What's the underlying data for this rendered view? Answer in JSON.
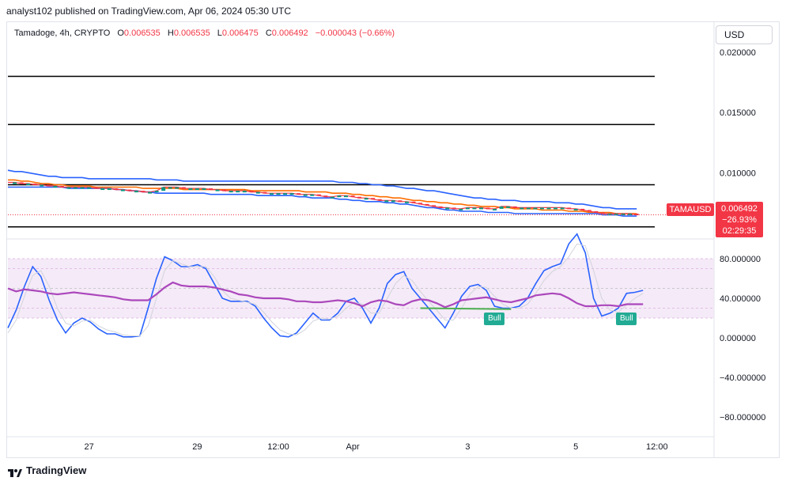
{
  "header": {
    "publisher": "analyst102 published on TradingView.com, Apr 06, 2024 05:30 UTC"
  },
  "legend": {
    "symbol": "Tamadoge, 4h, CRYPTO",
    "open_label": "O",
    "open": "0.006535",
    "high_label": "H",
    "high": "0.006535",
    "low_label": "L",
    "low": "0.006475",
    "close_label": "C",
    "close": "0.006492",
    "change": "−0.000043 (−0.66%)"
  },
  "currency_button": "USD",
  "price_tag": {
    "symbol": "TAMAUSD",
    "price": "0.006492",
    "change": "−26.93%",
    "countdown": "02:29:35"
  },
  "footer": {
    "brand": "TradingView"
  },
  "chart_data": [
    {
      "type": "line",
      "panel": "price",
      "y_ticks": [
        "0.020000",
        "0.015000",
        "0.010000"
      ],
      "ylim": [
        0.0045,
        0.0225
      ],
      "horizontal_levels": [
        0.018,
        0.014,
        0.009,
        0.0055
      ],
      "x_tick_labels": [
        "27",
        "29",
        "12:00",
        "Apr",
        "3",
        "5",
        "12:00"
      ],
      "x_tick_index": [
        12,
        28,
        40,
        51,
        68,
        84,
        96
      ],
      "series": [
        {
          "role": "upper_band",
          "color": "#2962ff",
          "values": [
            0.0102,
            0.0101,
            0.0101,
            0.01,
            0.0099,
            0.0098,
            0.0097,
            0.0097,
            0.0096,
            0.0096,
            0.0096,
            0.0096,
            0.0095,
            0.0095,
            0.0095,
            0.0095,
            0.0095,
            0.0095,
            0.0095,
            0.0095,
            0.0095,
            0.0095,
            0.0094,
            0.0094,
            0.0094,
            0.0094,
            0.0093,
            0.0093,
            0.0093,
            0.0093,
            0.0093,
            0.0093,
            0.0093,
            0.0093,
            0.0093,
            0.0093,
            0.0093,
            0.0093,
            0.0093,
            0.0093,
            0.0093,
            0.0093,
            0.0093,
            0.0093,
            0.0093,
            0.0093,
            0.0093,
            0.0093,
            0.0093,
            0.0092,
            0.0092,
            0.0092,
            0.0091,
            0.0091,
            0.009,
            0.009,
            0.0089,
            0.0089,
            0.0088,
            0.0087,
            0.0087,
            0.0086,
            0.0085,
            0.0085,
            0.0084,
            0.0083,
            0.0082,
            0.0081,
            0.008,
            0.0079,
            0.0079,
            0.0078,
            0.0078,
            0.0077,
            0.0077,
            0.0077,
            0.0076,
            0.0076,
            0.0076,
            0.0076,
            0.0076,
            0.0075,
            0.0075,
            0.0075,
            0.0074,
            0.0074,
            0.0073,
            0.0072,
            0.0071,
            0.0071,
            0.007,
            0.007,
            0.007,
            0.007
          ]
        },
        {
          "role": "middle_band",
          "color": "#ff6d00",
          "values": [
            0.0094,
            0.0094,
            0.0093,
            0.0093,
            0.0092,
            0.0091,
            0.0091,
            0.009,
            0.009,
            0.0089,
            0.0089,
            0.0089,
            0.0089,
            0.0088,
            0.0088,
            0.0088,
            0.0088,
            0.0088,
            0.0088,
            0.0088,
            0.0087,
            0.0087,
            0.0087,
            0.0087,
            0.0087,
            0.0087,
            0.0086,
            0.0086,
            0.0086,
            0.0086,
            0.0086,
            0.0086,
            0.0086,
            0.0086,
            0.0086,
            0.0086,
            0.0085,
            0.0085,
            0.0085,
            0.0085,
            0.0085,
            0.0085,
            0.0085,
            0.0085,
            0.0084,
            0.0084,
            0.0084,
            0.0084,
            0.0083,
            0.0083,
            0.0083,
            0.0082,
            0.0082,
            0.0081,
            0.0081,
            0.008,
            0.008,
            0.0079,
            0.0079,
            0.0078,
            0.0077,
            0.0077,
            0.0076,
            0.0076,
            0.0075,
            0.0075,
            0.0074,
            0.0074,
            0.0073,
            0.0073,
            0.0072,
            0.0072,
            0.0072,
            0.0071,
            0.0071,
            0.007,
            0.007,
            0.007,
            0.007,
            0.0069,
            0.0069,
            0.0069,
            0.0069,
            0.0068,
            0.0068,
            0.0068,
            0.0067,
            0.0067,
            0.0067,
            0.0067,
            0.0066,
            0.0066,
            0.0066,
            0.0066
          ]
        },
        {
          "role": "lower_band",
          "color": "#2962ff",
          "values": [
            0.0088,
            0.0088,
            0.0088,
            0.0088,
            0.0088,
            0.0088,
            0.0088,
            0.0088,
            0.0088,
            0.0087,
            0.0087,
            0.0087,
            0.0087,
            0.0087,
            0.0087,
            0.0087,
            0.0086,
            0.0086,
            0.0085,
            0.0085,
            0.0084,
            0.0084,
            0.0083,
            0.0083,
            0.0083,
            0.0083,
            0.0083,
            0.0083,
            0.0083,
            0.0083,
            0.0082,
            0.0082,
            0.0082,
            0.0082,
            0.0082,
            0.0082,
            0.0082,
            0.0081,
            0.0081,
            0.0081,
            0.0081,
            0.0081,
            0.0081,
            0.008,
            0.008,
            0.0079,
            0.0079,
            0.0079,
            0.0079,
            0.0078,
            0.0078,
            0.0077,
            0.0077,
            0.0076,
            0.0076,
            0.0076,
            0.0075,
            0.0075,
            0.0074,
            0.0074,
            0.0073,
            0.0072,
            0.0071,
            0.0071,
            0.007,
            0.0069,
            0.0069,
            0.0068,
            0.0068,
            0.0068,
            0.0068,
            0.0067,
            0.0067,
            0.0067,
            0.0067,
            0.0066,
            0.0066,
            0.0066,
            0.0066,
            0.0066,
            0.0066,
            0.0066,
            0.0066,
            0.0066,
            0.0066,
            0.0066,
            0.0066,
            0.0066,
            0.0065,
            0.0065,
            0.0065,
            0.0064,
            0.0064,
            0.0064
          ]
        },
        {
          "role": "price",
          "color": "#f23645",
          "values": [
            0.0092,
            0.0092,
            0.0091,
            0.0091,
            0.009,
            0.009,
            0.0089,
            0.0089,
            0.0088,
            0.0088,
            0.0088,
            0.0088,
            0.0088,
            0.0087,
            0.0087,
            0.0087,
            0.0086,
            0.0086,
            0.0085,
            0.0085,
            0.0084,
            0.0084,
            0.0085,
            0.0088,
            0.0088,
            0.0088,
            0.0087,
            0.0087,
            0.0087,
            0.0087,
            0.0086,
            0.0086,
            0.0085,
            0.0085,
            0.0085,
            0.0085,
            0.0084,
            0.0084,
            0.0083,
            0.0083,
            0.0083,
            0.0083,
            0.0083,
            0.0082,
            0.0082,
            0.0082,
            0.0081,
            0.008,
            0.008,
            0.0081,
            0.0081,
            0.008,
            0.0079,
            0.0079,
            0.0078,
            0.0077,
            0.0077,
            0.0077,
            0.0076,
            0.0076,
            0.0075,
            0.0074,
            0.0073,
            0.0072,
            0.0071,
            0.0071,
            0.007,
            0.007,
            0.0071,
            0.0071,
            0.0071,
            0.007,
            0.007,
            0.0072,
            0.0072,
            0.0071,
            0.0071,
            0.0071,
            0.0071,
            0.0071,
            0.0071,
            0.0071,
            0.0071,
            0.007,
            0.007,
            0.0069,
            0.0068,
            0.0067,
            0.0066,
            0.0066,
            0.0066,
            0.0066,
            0.0066,
            0.0065
          ]
        }
      ]
    },
    {
      "type": "line",
      "panel": "stochastic_rsi",
      "y_ticks": [
        "80.000000",
        "40.000000",
        "0.000000",
        "−40.000000",
        "−80.000000"
      ],
      "ylim": [
        -100,
        100
      ],
      "bands": [
        80,
        70,
        50,
        30,
        20
      ],
      "signals": [
        {
          "label": "Bull",
          "index": 59
        },
        {
          "label": "Bull",
          "index": 75
        }
      ],
      "series": [
        {
          "role": "k",
          "color": "#2962ff",
          "values": [
            10,
            28,
            52,
            72,
            62,
            38,
            18,
            5,
            15,
            20,
            16,
            9,
            4,
            4,
            1,
            1,
            2,
            30,
            60,
            82,
            78,
            72,
            72,
            74,
            70,
            55,
            40,
            37,
            37,
            37,
            32,
            20,
            10,
            2,
            1,
            5,
            15,
            25,
            18,
            18,
            25,
            37,
            40,
            30,
            15,
            30,
            55,
            64,
            67,
            50,
            40,
            30,
            20,
            10,
            25,
            42,
            52,
            54,
            48,
            32,
            30,
            30,
            32,
            40,
            55,
            68,
            72,
            75,
            95,
            105,
            86,
            40,
            22,
            25,
            30,
            45,
            46,
            48
          ]
        },
        {
          "role": "d",
          "color": "#d1d4dc",
          "values": [
            5,
            18,
            42,
            63,
            68,
            52,
            30,
            15,
            12,
            17,
            18,
            12,
            8,
            6,
            3,
            2,
            2,
            12,
            40,
            68,
            78,
            75,
            72,
            72,
            72,
            62,
            48,
            40,
            38,
            36,
            34,
            26,
            16,
            8,
            4,
            3,
            8,
            17,
            20,
            19,
            22,
            30,
            36,
            34,
            25,
            25,
            40,
            55,
            63,
            58,
            47,
            37,
            28,
            18,
            18,
            30,
            44,
            52,
            51,
            42,
            34,
            30,
            30,
            34,
            45,
            58,
            67,
            72,
            82,
            95,
            93,
            68,
            40,
            28,
            26,
            33,
            40,
            45
          ]
        },
        {
          "role": "rsi",
          "color": "#ab47bc",
          "values": [
            50,
            47,
            49,
            48,
            47,
            45,
            44,
            45,
            46,
            45,
            44,
            43,
            42,
            41,
            39,
            38,
            38,
            38,
            44,
            51,
            56,
            53,
            52,
            52,
            52,
            51,
            49,
            47,
            44,
            43,
            41,
            40,
            40,
            40,
            39,
            37,
            37,
            36,
            36,
            37,
            38,
            37,
            35,
            32,
            36,
            38,
            37,
            34,
            33,
            37,
            39,
            38,
            35,
            31,
            34,
            38,
            39,
            40,
            41,
            39,
            37,
            36,
            38,
            40,
            43,
            44,
            45,
            44,
            40,
            35,
            32,
            32,
            33,
            33,
            32,
            34,
            34,
            34
          ]
        }
      ]
    }
  ]
}
